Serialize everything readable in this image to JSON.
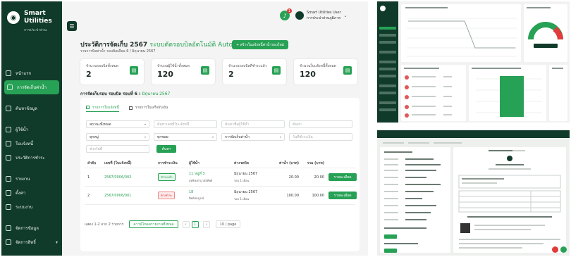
{
  "app": {
    "brand_line1": "Smart",
    "brand_line2": "Utilities",
    "brand_sub": "การประปาส่วนภูมิภาค"
  },
  "sidebar": {
    "items": [
      {
        "label": "หน้าแรก",
        "active": false
      },
      {
        "label": "การจัดเก็บค่าน้ำ",
        "active": true
      },
      {
        "label": "ค้นหาข้อมูล",
        "active": false
      },
      {
        "label": "ผู้ใช้น้ำ",
        "active": false
      },
      {
        "label": "ใบแจ้งหนี้",
        "active": false
      },
      {
        "label": "ประวัติการชำระ",
        "active": false
      },
      {
        "label": "รายงาน",
        "active": false
      },
      {
        "label": "ตั้งค่า",
        "active": false
      },
      {
        "label": "ระบบงาน",
        "active": false
      },
      {
        "label": "จัดการข้อมูล",
        "active": false
      },
      {
        "label": "จัดการสิทธิ์",
        "active": false
      }
    ]
  },
  "header": {
    "notification_count": "1",
    "user_name": "Smart Utilities User",
    "user_org": "การประปาส่วนภูมิภาค"
  },
  "page": {
    "title": "ประวัติการจัดเก็บ 2567",
    "title_highlight": "ระบบตัดรอบบิลอัตโนมัติ Auto",
    "subtitle": "รายการบิลค่าน้ำ รอบบิลเดือน 6 / มิถุนายน 2567",
    "create_button": "+ สร้างใบแจ้งหนี้ค่าน้ำรอบใหม่"
  },
  "stats": [
    {
      "label": "จำนวนรอบบิลทั้งหมด",
      "value": "2"
    },
    {
      "label": "จำนวนผู้ใช้น้ำทั้งหมด",
      "value": "120"
    },
    {
      "label": "จำนวนรอบบิลที่ชำระแล้ว",
      "value": "2"
    },
    {
      "label": "จำนวนใบแจ้งหนี้ทั้งหมด",
      "value": "120"
    }
  ],
  "billing": {
    "title": "การจัดเก็บรอบ รอบบิล รอบที่ 6 :",
    "title_month": "มิถุนายน 2567"
  },
  "tabs": [
    {
      "label": "รายการใบแจ้งหนี้",
      "active": true
    },
    {
      "label": "รายการใบเสร็จรับเงิน",
      "active": false
    }
  ],
  "filters": {
    "f1": "สถานะทั้งหมด",
    "f2": "ค้นหาเลขที่ใบแจ้งหนี้",
    "f3": "ค้นหาชื่อผู้ใช้น้ำ",
    "f4": "ค้นหา",
    "f5": "ทุกหมู่",
    "f6": "ทุกซอย",
    "f7": "การจัดเก็บค่าน้ำ",
    "f8": "วันที่ชำระเงิน",
    "f9": "ช่วงวันที่",
    "search_button": "ค้นหา"
  },
  "table": {
    "headers": [
      "ลำดับ",
      "เลขที่ (ใบแจ้งหนี้)",
      "การชำระเงิน",
      "ผู้ใช้น้ำ",
      "ค่างวดบิล",
      "ค่าน้ำ (บาท)",
      "รวม (บาท)",
      ""
    ],
    "rows": [
      {
        "index": "1",
        "invoice_no": "2567/0006/002",
        "status": "ชำระแล้ว",
        "status_type": "ok",
        "meter": "11 หมู่ที่ 3",
        "user": "สุทธิพงษ์ มาลัยทิพย์",
        "period": "มิถุนายน 2567",
        "period_sub": "รอบ 1 เดือน",
        "water_fee": "20.00",
        "total": "20.00",
        "action": "รายละเอียด"
      },
      {
        "index": "2",
        "invoice_no": "2567/0006/001",
        "status": "ค้างชำระ",
        "status_type": "bad",
        "meter": "18",
        "user": "ทิพย์สมบูรณ์",
        "period": "มิถุนายน 2567",
        "period_sub": "รอบ 1 เดือน",
        "water_fee": "100.00",
        "total": "100.00",
        "action": "รายละเอียด"
      }
    ]
  },
  "pager": {
    "summary": "แสดง 1-2 จาก 2 รายการ",
    "export_button": "ดาวน์โหลดรายงานทั้งหมด",
    "prev": "‹",
    "current": "1",
    "next": "›",
    "page_size": "10 / page"
  },
  "colors": {
    "sidebar": "#103a2a",
    "accent": "#27a155",
    "danger": "#e23b3b"
  },
  "icons": {
    "menu": "menu-icon",
    "bell": "bell-icon",
    "card": "document-icon",
    "search": "search-icon"
  }
}
